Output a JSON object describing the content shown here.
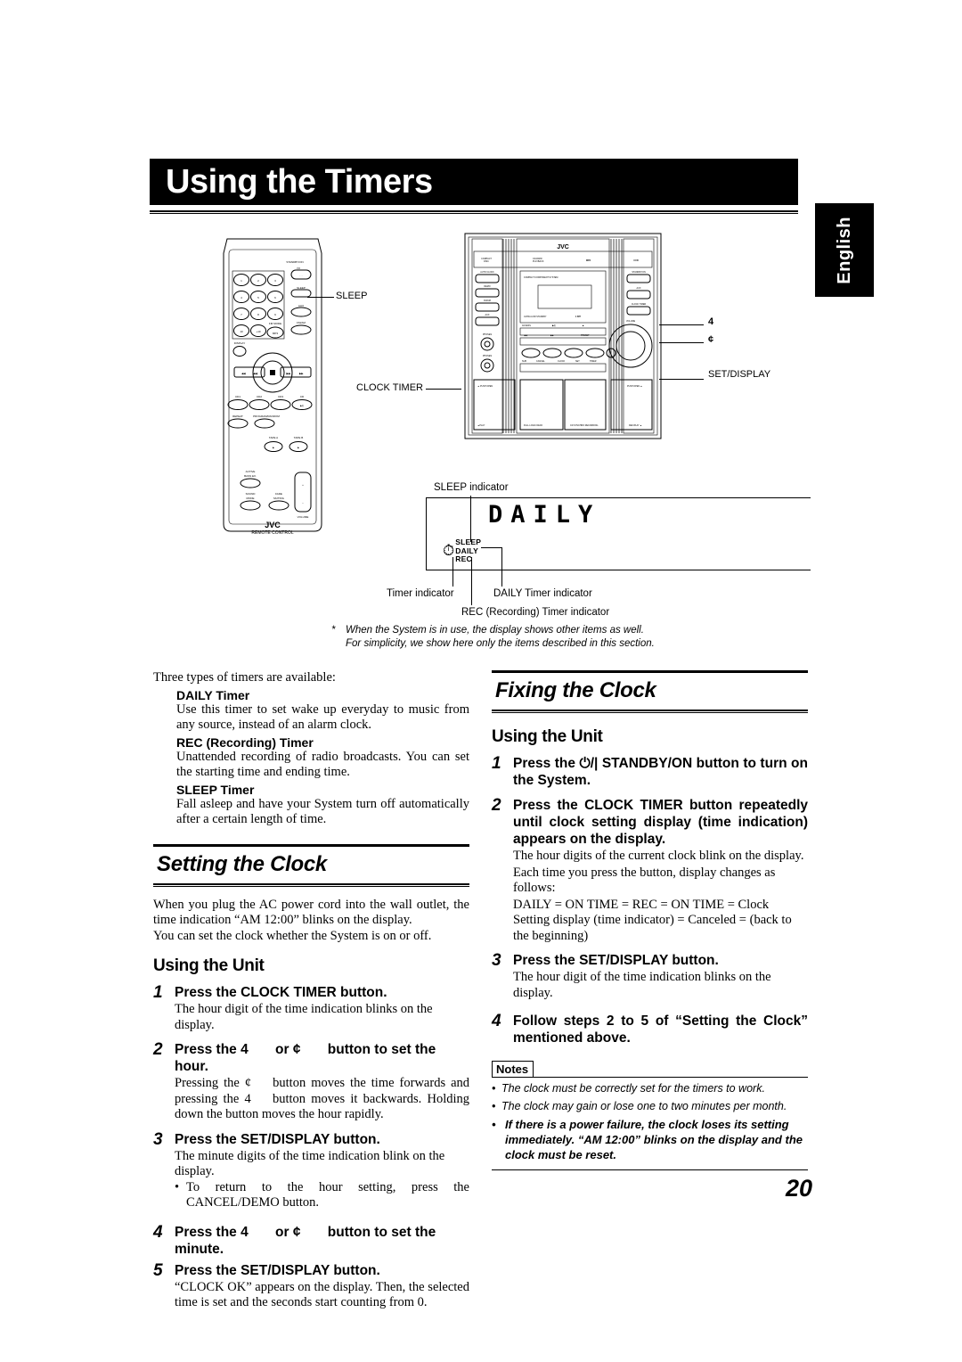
{
  "page": {
    "title": "Using the Timers",
    "language_tab": "English",
    "number": "20"
  },
  "figure": {
    "remote_callouts": [
      {
        "label": "SLEEP"
      },
      {
        "label": "CLOCK TIMER"
      }
    ],
    "system_callouts": [
      {
        "label": "4"
      },
      {
        "label": "¢"
      },
      {
        "label": "SET/DISPLAY"
      }
    ],
    "remote": {
      "brand": "JVC",
      "brand_sub": "REMOTE CONTROL",
      "standby_label": "STANDBY/ON",
      "standby_glyph": "⏻/I",
      "number_keys": [
        "1",
        "2",
        "3",
        "4",
        "5",
        "6",
        "7",
        "8",
        "9",
        "10",
        "+10"
      ],
      "side_buttons": [
        "SLEEP",
        "AUX",
        "FM/AM"
      ],
      "fm_mode_label": "FM MODE",
      "mp3_label": "MP3",
      "display_label": "DISPLAY",
      "source_buttons": [
        "CD1",
        "CD2",
        "CD3",
        "CD"
      ],
      "function_buttons": [
        "REPEAT",
        "PROGRAM/RANDOM"
      ],
      "tape_buttons": [
        "TAPE A",
        "TAPE B"
      ],
      "sound_buttons": [
        "ACTIVE BASS EX.",
        "SOUND MODE",
        "FADE MUTING"
      ],
      "volume_label": "VOLUME"
    },
    "system": {
      "brand": "JVC",
      "subtitle": "COMPACT COMPONENT SYSTEM",
      "top_labels": [
        "COMPACT DISC",
        "CD-R/RW PLAYBACK",
        "MP3",
        "3 CD"
      ],
      "left_labels": [
        "AUTO CLOCK",
        "DEMO",
        "FM/AM",
        "AUX"
      ],
      "right_labels": [
        "STANDBY/ON",
        "AUX",
        "CLOCK TIMER",
        "VOLUME"
      ],
      "display_labels": [
        "ULTRA LOW STANDBY",
        "COMPACT COMPONENT SYSTEM"
      ],
      "deck_labels": [
        "PLAY",
        "FULL LOGIC DECK",
        "CD SYNCHRO RECORDING",
        "REC/PLAY"
      ]
    },
    "display_panel": {
      "segment_text": "DAILY",
      "indicators": [
        "SLEEP",
        "DAILY",
        "REC"
      ],
      "timer_glyph": "⏱",
      "labels": {
        "sleep_indicator": "SLEEP indicator",
        "timer_indicator": "Timer indicator",
        "daily_indicator": "DAILY Timer indicator",
        "rec_indicator": "REC (Recording) Timer indicator"
      }
    },
    "footnote": {
      "marker": "*",
      "line1": "When the System is in use, the display shows other items as well.",
      "line2": "For simplicity, we show here only the items described in this section."
    }
  },
  "left_column": {
    "intro": "Three types of timers are available:",
    "timer_types": [
      {
        "name": "DAILY Timer",
        "desc": "Use this timer to set wake up everyday to music from any source, instead of an alarm clock."
      },
      {
        "name": "REC (Recording) Timer",
        "desc": "Unattended recording of radio broadcasts. You can set the starting time and ending time."
      },
      {
        "name": "SLEEP Timer",
        "desc": "Fall asleep and have your System turn off automatically after a certain length of time."
      }
    ],
    "section_heading": "Setting the Clock",
    "section_intro_1": "When you plug the AC power cord into the wall outlet, the time indication “AM 12:00” blinks on the display.",
    "section_intro_2": "You can set the clock whether the System is on or off.",
    "subheading": "Using the Unit",
    "steps": [
      {
        "num": "1",
        "title": "Press the CLOCK TIMER button.",
        "body": "The hour digit of the time indication blinks on the display."
      },
      {
        "num": "2",
        "title_a": "Press the",
        "title_sym1": "4",
        "title_b": "or",
        "title_sym2": "¢",
        "title_c": "button to set the hour.",
        "body_a": "Pressing the",
        "body_sym1": "¢",
        "body_b": "button moves the time forwards and pressing the",
        "body_sym2": "4",
        "body_c": "button moves it backwards. Holding down the button moves the hour rapidly."
      },
      {
        "num": "3",
        "title": "Press the SET/DISPLAY button.",
        "body": "The minute digits of the time indication blink on the display.",
        "bullet": "To return to the hour setting, press the CANCEL/DEMO button."
      },
      {
        "num": "4",
        "title_a": "Press the",
        "title_sym1": "4",
        "title_b": "or",
        "title_sym2": "¢",
        "title_c": "button to set the minute."
      },
      {
        "num": "5",
        "title": "Press the SET/DISPLAY button.",
        "body": "“CLOCK OK” appears on the display. Then, the selected time is set and the seconds start counting from 0."
      }
    ]
  },
  "right_column": {
    "section_heading": "Fixing the Clock",
    "subheading": "Using the Unit",
    "steps": [
      {
        "num": "1",
        "title_a": "Press the",
        "title_sym": "⏻/|",
        "title_b": "STANDBY/ON button to turn on the System."
      },
      {
        "num": "2",
        "title": "Press the CLOCK TIMER button repeatedly until clock setting display (time indication) appears on the display.",
        "body_1": "The hour digits of the current clock blink on the display.",
        "body_2": "Each time you press the button, display changes as follows:",
        "body_3": "DAILY =  ON TIME =  REC =  ON TIME =  Clock Setting display (time indicator) =  Canceled =  (back to the beginning)"
      },
      {
        "num": "3",
        "title": "Press the SET/DISPLAY button.",
        "body": "The hour digit of the time indication blinks on the display."
      },
      {
        "num": "4",
        "title": "Follow steps 2 to 5 of “Setting the Clock” mentioned above."
      }
    ],
    "notes": {
      "label": "Notes",
      "items": [
        {
          "text": "The clock must be correctly set for the timers to work.",
          "bold": false
        },
        {
          "text": "The clock may gain or lose one to two minutes per month.",
          "bold": false
        },
        {
          "text": "If there is a power failure, the clock loses its setting immediately. “AM 12:00” blinks on the display and the clock must be reset.",
          "bold": true
        }
      ]
    }
  }
}
